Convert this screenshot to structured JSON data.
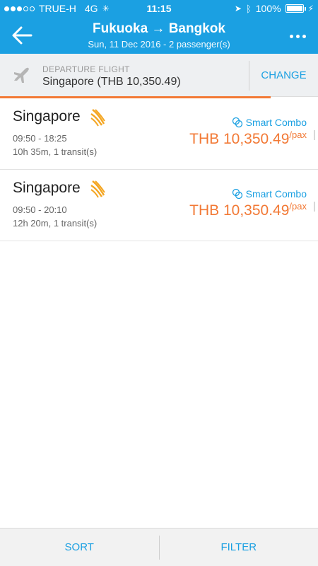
{
  "status_bar": {
    "carrier": "TRUE-H",
    "network": "4G",
    "time": "11:15",
    "battery": "100%",
    "battery_level": 1.0
  },
  "header": {
    "title": "Fukuoka → Bangkok",
    "subtitle": "Sun, 11 Dec 2016 - 2 passenger(s)",
    "back_icon": "arrow-left-icon",
    "menu_icon": "more-dots-icon"
  },
  "departure": {
    "label": "DEPARTURE FLIGHT",
    "value": "Singapore (THB 10,350.49)",
    "change_label": "CHANGE",
    "icon": "airplane-icon"
  },
  "load_progress": 0.85,
  "flights": [
    {
      "airline": "Singapore",
      "times": "09:50 - 18:25",
      "duration": "10h 35m, 1 transit(s)",
      "combo_label": "Smart Combo",
      "price": "THB 10,350.49",
      "per": "/pax"
    },
    {
      "airline": "Singapore",
      "times": "09:50 - 20:10",
      "duration": "12h 20m, 1 transit(s)",
      "combo_label": "Smart Combo",
      "price": "THB 10,350.49",
      "per": "/pax"
    }
  ],
  "bottom_bar": {
    "sort_label": "SORT",
    "filter_label": "FILTER"
  },
  "colors": {
    "primary": "#1ba0e2",
    "accent": "#f27935"
  }
}
